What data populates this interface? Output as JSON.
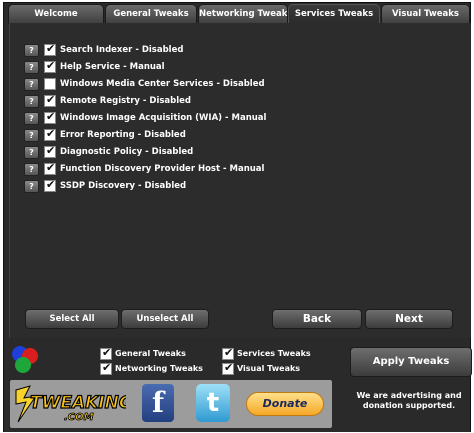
{
  "tabs": [
    "Welcome",
    "General Tweaks",
    "Networking Tweaks",
    "Services Tweaks",
    "Visual Tweaks"
  ],
  "active_tab": "Services Tweaks",
  "services": [
    {
      "label": "Search Indexer - Disabled",
      "checked": true
    },
    {
      "label": "Help Service - Manual",
      "checked": true
    },
    {
      "label": "Windows Media Center Services - Disabled",
      "checked": false
    },
    {
      "label": "Remote Registry - Disabled",
      "checked": true
    },
    {
      "label": "Windows Image Acquisition (WIA) - Manual",
      "checked": true
    },
    {
      "label": "Error Reporting - Disabled",
      "checked": true
    },
    {
      "label": "Diagnostic Policy - Disabled",
      "checked": true
    },
    {
      "label": "Function Discovery Provider Host - Manual",
      "checked": true
    },
    {
      "label": "SSDP Discovery - Disabled",
      "checked": true
    }
  ],
  "help_label": "?",
  "buttons": {
    "select_all": "Select All",
    "unselect_all": "Unselect All",
    "back": "Back",
    "next": "Next",
    "apply": "Apply Tweaks"
  },
  "bottom_checkboxes": [
    {
      "label": "General Tweaks",
      "checked": true
    },
    {
      "label": "Services Tweaks",
      "checked": true
    },
    {
      "label": "Networking Tweaks",
      "checked": true
    },
    {
      "label": "Visual Tweaks",
      "checked": true
    }
  ],
  "ad_text": "We are advertising and donation supported.",
  "logo_text": {
    "main": "TWEAKING",
    "sub": ".COM"
  },
  "donate_label": "Donate",
  "icons": {
    "facebook": "f",
    "twitter": "t"
  },
  "colors": {
    "background": "#2a2a2a",
    "logo_bar": "#9c9c9c",
    "donate": "#f6a826"
  }
}
